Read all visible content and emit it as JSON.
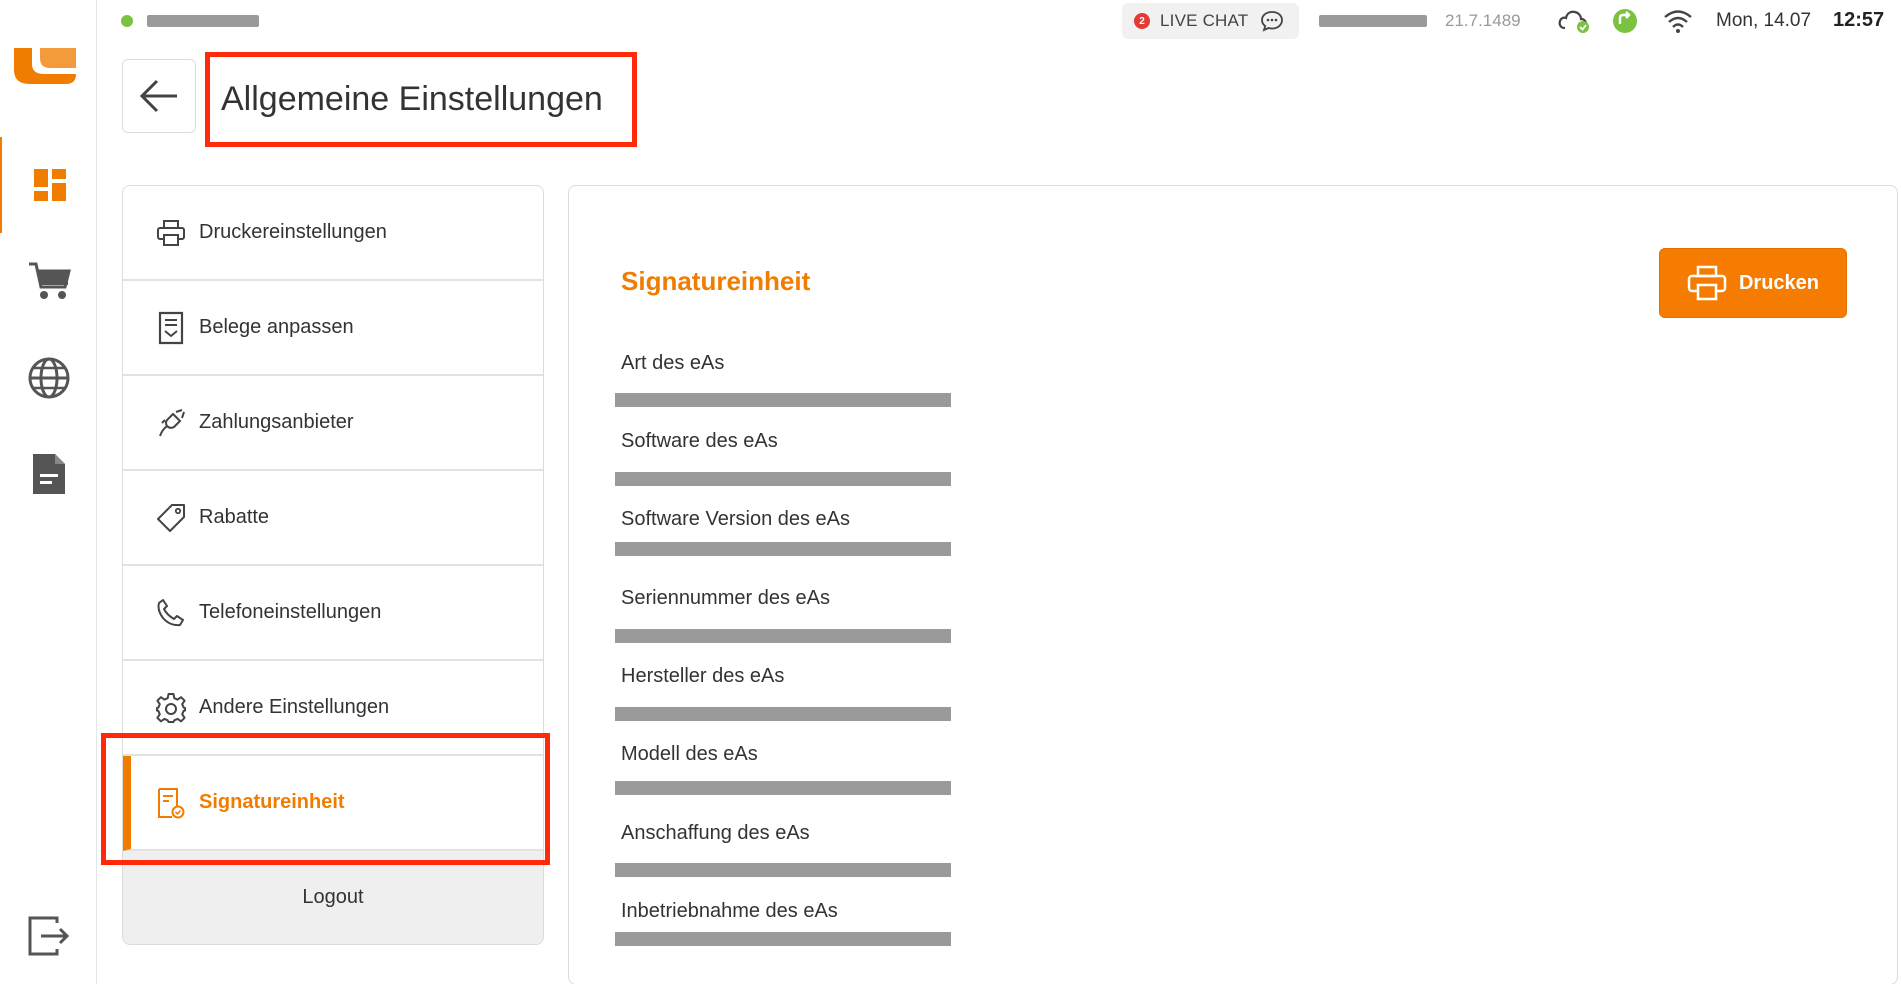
{
  "status": {
    "live_chat_count": "2",
    "live_chat_label": "LIVE CHAT",
    "version": "21.7.1489",
    "date": "Mon, 14.07",
    "time": "12:57"
  },
  "header": {
    "title": "Allgemeine Einstellungen"
  },
  "menu": {
    "items": [
      {
        "label": "Druckereinstellungen",
        "icon": "printer-icon"
      },
      {
        "label": "Belege anpassen",
        "icon": "receipt-icon"
      },
      {
        "label": "Zahlungsanbieter",
        "icon": "plug-icon"
      },
      {
        "label": "Rabatte",
        "icon": "tag-icon"
      },
      {
        "label": "Telefoneinstellungen",
        "icon": "phone-icon"
      },
      {
        "label": "Andere Einstellungen",
        "icon": "gear-icon"
      },
      {
        "label": "Signatureinheit",
        "icon": "signature-document-icon"
      }
    ],
    "logout_label": "Logout"
  },
  "panel": {
    "title": "Signatureinheit",
    "print_label": "Drucken",
    "fields": [
      {
        "label": "Art des eAs"
      },
      {
        "label": "Software des eAs"
      },
      {
        "label": "Software Version des eAs"
      },
      {
        "label": "Seriennummer des eAs"
      },
      {
        "label": "Hersteller des eAs"
      },
      {
        "label": "Modell des eAs"
      },
      {
        "label": "Anschaffung des eAs"
      },
      {
        "label": "Inbetriebnahme des eAs"
      }
    ]
  },
  "colors": {
    "accent": "#f07d00",
    "highlight": "#ff2a0a",
    "online": "#7cc242"
  }
}
